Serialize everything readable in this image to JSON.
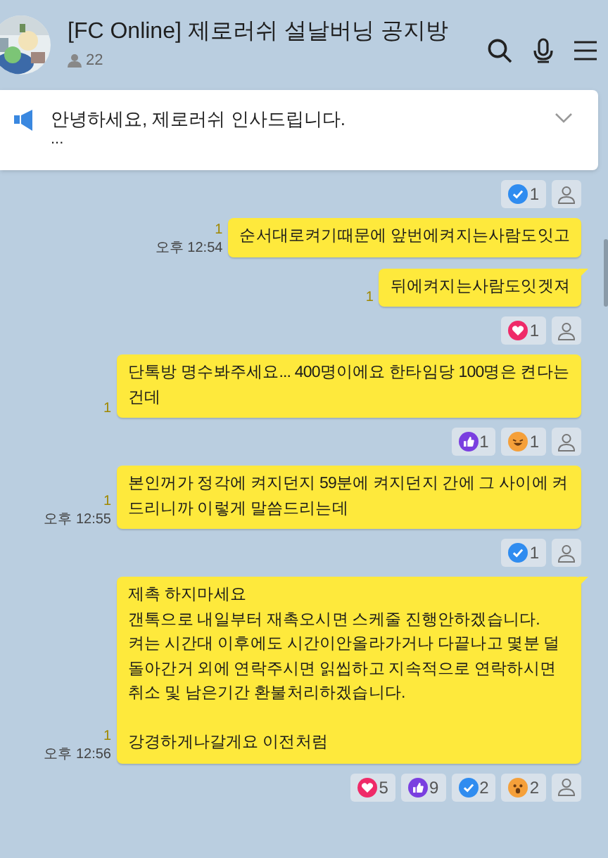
{
  "header": {
    "title": "[FC Online] 제로러쉬 설날버닝 공지방",
    "members": "22"
  },
  "notice": {
    "text": "안녕하세요, 제로러쉬 인사드립니다.",
    "more": "...",
    "expanded": false
  },
  "feed": [
    {
      "kind": "reactions",
      "reactions": [
        {
          "kind": "check",
          "count": "1"
        }
      ]
    },
    {
      "kind": "message",
      "text": "순서대로켜기때문에 앞번에켜지는사람도잇고",
      "unread": "1",
      "time": "오후 12:54",
      "tail": false
    },
    {
      "kind": "message",
      "text": "뒤에켜지는사람도잇겟져",
      "unread": "1",
      "tail": true
    },
    {
      "kind": "reactions",
      "reactions": [
        {
          "kind": "heart",
          "count": "1"
        }
      ]
    },
    {
      "kind": "message",
      "text": "단톡방 명수봐주세요... 400명이에요 한타임당 100명은 켠다는건데",
      "unread": "1",
      "tail": false
    },
    {
      "kind": "reactions",
      "reactions": [
        {
          "kind": "like",
          "count": "1"
        },
        {
          "kind": "laugh",
          "count": "1"
        }
      ]
    },
    {
      "kind": "message",
      "text": "본인꺼가 정각에 켜지던지 59분에 켜지던지 간에 그 사이에 켜드리니까 이렇게 말씀드리는데",
      "unread": "1",
      "time": "오후 12:55",
      "tail": false
    },
    {
      "kind": "reactions",
      "reactions": [
        {
          "kind": "check",
          "count": "1"
        }
      ]
    },
    {
      "kind": "message",
      "text": "제촉 하지마세요\n갠톡으로 내일부터 재촉오시면 스케줄 진행안하겠습니다.\n켜는 시간대 이후에도 시간이안올라가거나 다끝나고 몇분 덜 돌아간거 외에 연락주시면 읽씹하고 지속적으로 연락하시면 취소 및 남은기간 환불처리하겠습니다.\n\n강경하게나갈게요 이전처럼",
      "unread": "1",
      "time": "오후 12:56",
      "tail": true
    },
    {
      "kind": "reactions",
      "reactions": [
        {
          "kind": "heart",
          "count": "5"
        },
        {
          "kind": "like",
          "count": "9"
        },
        {
          "kind": "check",
          "count": "2"
        },
        {
          "kind": "wow",
          "count": "2"
        }
      ]
    }
  ]
}
